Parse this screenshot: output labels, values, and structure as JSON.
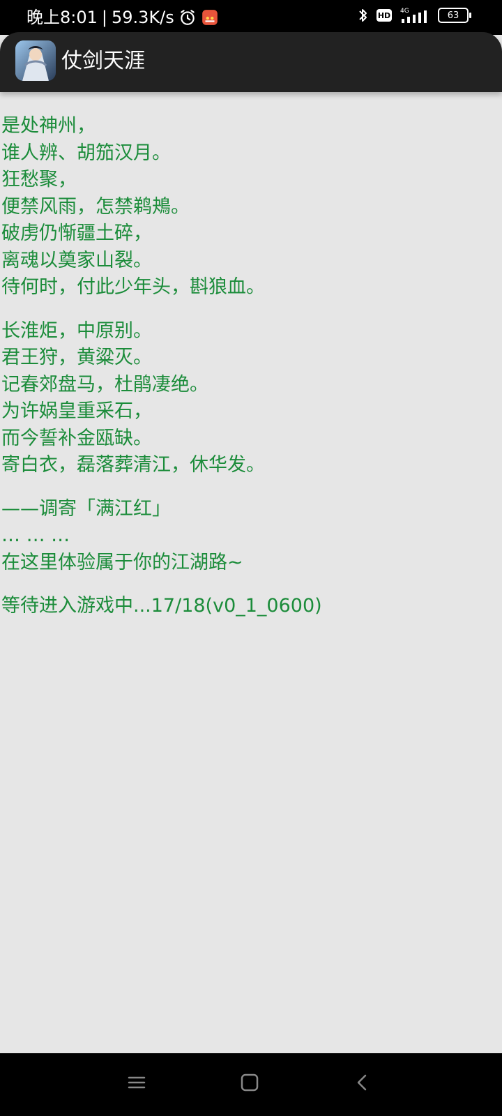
{
  "status_bar": {
    "time": "晚上8:01",
    "separator": "|",
    "speed": "59.3K/s",
    "hd_label": "HD",
    "network": "4G",
    "battery": "63"
  },
  "app_bar": {
    "title": "仗剑天涯"
  },
  "content": {
    "stanza1": [
      "是处神州，",
      "谁人辨、胡笳汉月。",
      "狂愁聚，",
      "便禁风雨，怎禁鹈鴂。",
      "破虏仍惭疆土碎，",
      "离魂以奠家山裂。",
      "待何时，付此少年头，斟狼血。"
    ],
    "stanza2": [
      "长淮炬，中原别。",
      "君王狩，黄粱灭。",
      "记春郊盘马，杜鹃凄绝。",
      "为许娲皇重采石，",
      "而今誓补金瓯缺。",
      "寄白衣，磊落葬清江，休华发。"
    ],
    "stanza3": [
      "——调寄「满江红」",
      "… … …",
      "在这里体验属于你的江湖路~"
    ],
    "status_line": "等待进入游戏中...17/18(v0_1_0600)"
  },
  "nav_bar": {
    "menu_icon": "menu-icon",
    "home_icon": "home-icon",
    "back_icon": "back-icon"
  }
}
